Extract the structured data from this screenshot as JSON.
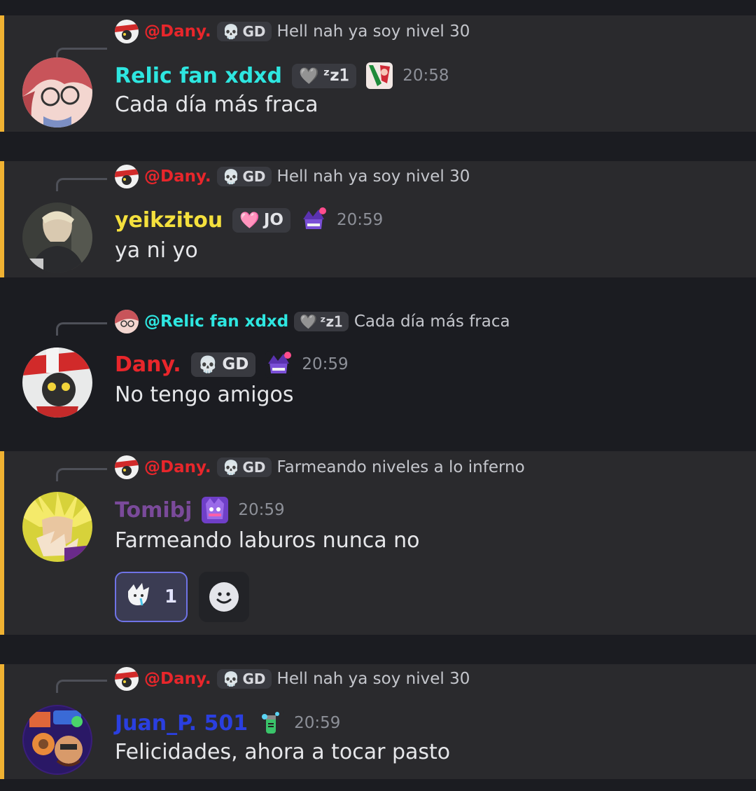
{
  "colors": {
    "mention_bar": "#f0b232",
    "dany": "#e8262b",
    "relic": "#2ee6e0",
    "yeik": "#f4e03d",
    "tomi": "#7a4a9a",
    "juan": "#2a3fe0"
  },
  "messages": [
    {
      "reply": {
        "mention": "@Dany.",
        "tag": "GD",
        "tag_icon": "skull-icon",
        "text": "Hell nah ya soy nivel 30"
      },
      "username": "Relic fan xdxd",
      "tag": "ᶻz𝟣",
      "tag_icon": "heart-icon",
      "time": "20:58",
      "text": "Cada día más fraca"
    },
    {
      "reply": {
        "mention": "@Dany.",
        "tag": "GD",
        "tag_icon": "skull-icon",
        "text": "Hell nah ya soy nivel 30"
      },
      "username": "yeikzitou",
      "tag": "JO",
      "tag_icon": "pink-heart-icon",
      "time": "20:59",
      "text": "ya ni yo"
    },
    {
      "reply": {
        "mention": "@Relic fan xdxd",
        "tag": "ᶻz𝟣",
        "tag_icon": "heart-icon",
        "text": "Cada día más fraca"
      },
      "username": "Dany.",
      "tag": "GD",
      "tag_icon": "skull-icon",
      "time": "20:59",
      "text": "No tengo amigos"
    },
    {
      "reply": {
        "mention": "@Dany.",
        "tag": "GD",
        "tag_icon": "skull-icon",
        "text": "Farmeando niveles a lo inferno"
      },
      "username": "Tomibj",
      "time": "20:59",
      "text": "Farmeando laburos nunca no",
      "reaction": {
        "emoji": "crying-face-icon",
        "count": "1"
      }
    },
    {
      "reply": {
        "mention": "@Dany.",
        "tag": "GD",
        "tag_icon": "skull-icon",
        "text": "Hell nah ya soy nivel 30"
      },
      "username": "Juan_P. 501",
      "time": "20:59",
      "text": "Felicidades, ahora a tocar pasto"
    }
  ]
}
